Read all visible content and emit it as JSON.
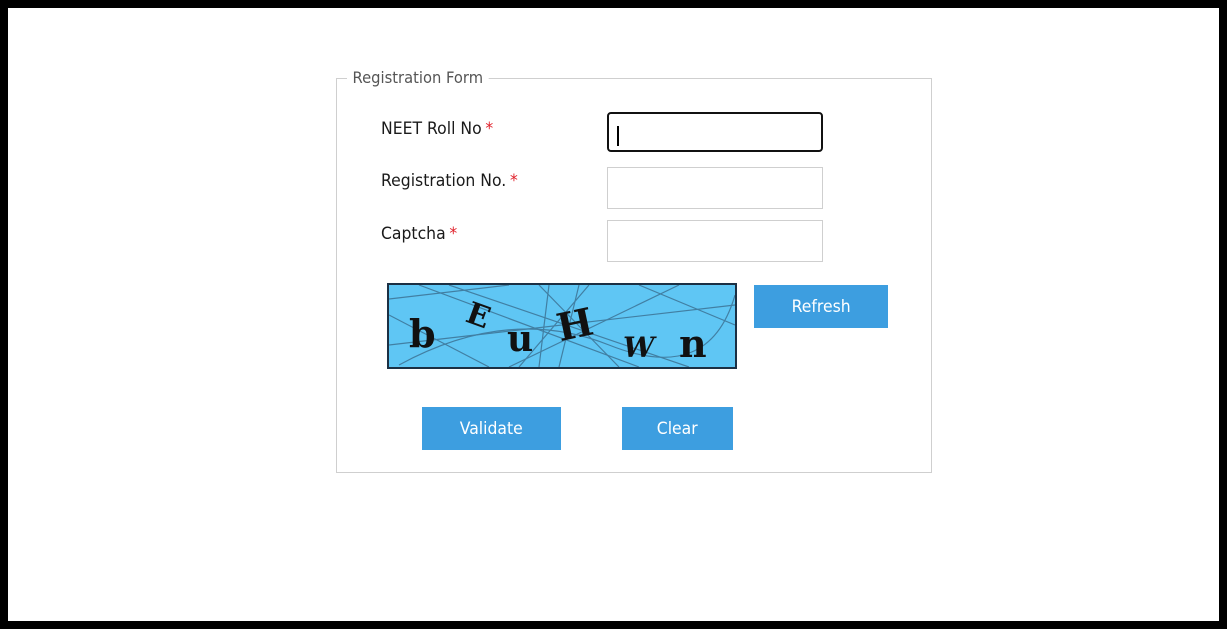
{
  "form": {
    "legend": "Registration Form",
    "required_marker": "*",
    "fields": [
      {
        "label": "NEET Roll No",
        "value": ""
      },
      {
        "label": "Registration No.",
        "value": ""
      },
      {
        "label": "Captcha",
        "value": ""
      }
    ],
    "captcha_text": "bEuHWn",
    "captcha_chars": [
      "b",
      "E",
      "u",
      "H",
      "W",
      "n"
    ],
    "buttons": {
      "refresh": "Refresh",
      "validate": "Validate",
      "clear": "Clear"
    }
  },
  "colors": {
    "button": "#3d9ee0",
    "required": "#e0202a",
    "captcha_bg": "#5fc6f4"
  }
}
